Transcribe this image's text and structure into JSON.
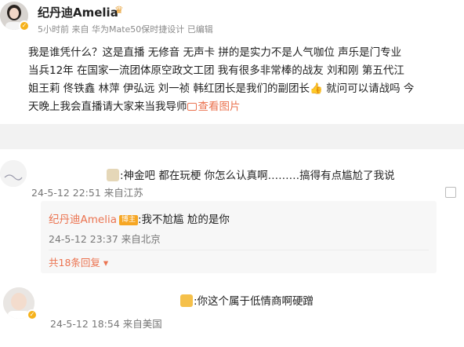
{
  "post": {
    "username": "纪丹迪Amelia",
    "crown_icon": "crown-icon",
    "verify_icon": "verified-badge-icon",
    "meta": {
      "time": "5小时前",
      "source": "来自 华为Mate50保时捷设计",
      "edited": "已编辑"
    },
    "lines": [
      "我是谁凭什么？这是直播  无修音 无声卡  拼的是实力不是人气咖位 声乐是门专业",
      "当兵12年  在国家一流团体原空政文工团 我有很多非常棒的战友 刘和刚  第五代江",
      "姐王莉 佟铁鑫 林萍 伊弘远 刘一祯 韩红团长是我们的副团长",
      "天晚上我会直播请大家来当我导师"
    ],
    "line3_tail": " 就问可以请战吗 今",
    "see_image": "查看图片"
  },
  "comments": [
    {
      "text": ":神金吧 都在玩梗 你怎么认真啊………搞得有点尴尬了我说",
      "date": "24-5-12 22:51 来自江苏",
      "reply": {
        "username": "纪丹迪Amelia",
        "badge": "博主",
        "text": ":我不尬尴 尬的是你",
        "date": "24-5-12 23:37 来自北京"
      },
      "more_replies": "共18条回复"
    },
    {
      "text": ":你这个属于低情商啊硬蹭",
      "date": "24-5-12 18:54 来自美国"
    }
  ]
}
